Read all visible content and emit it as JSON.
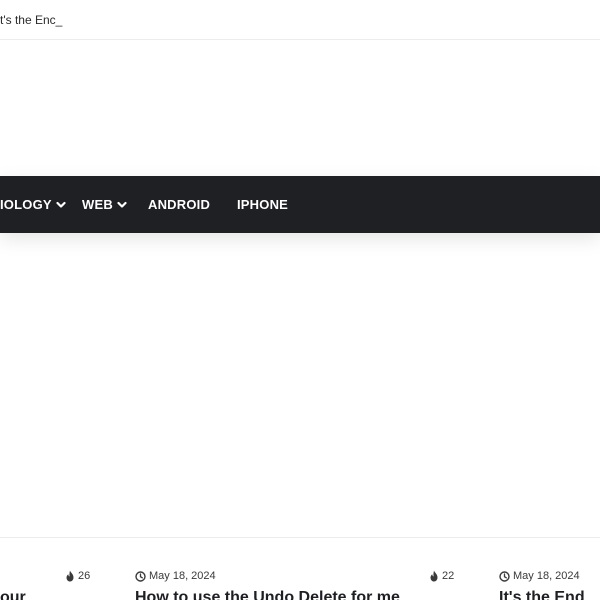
{
  "ticker": {
    "text": "t's the Enc_"
  },
  "nav": {
    "items": [
      {
        "label": "IOLOGY",
        "has_dropdown": true
      },
      {
        "label": "WEB",
        "has_dropdown": true
      },
      {
        "label": "ANDROID",
        "has_dropdown": false
      },
      {
        "label": "IPHONE",
        "has_dropdown": false
      }
    ]
  },
  "posts": [
    {
      "views": "26",
      "title": "our",
      "date": ""
    },
    {
      "date": "May 18, 2024",
      "views": "22",
      "title": "How to use the Undo Delete for me"
    },
    {
      "date": "May 18, 2024",
      "title": "It's the End"
    }
  ],
  "icons": {
    "flame": "flame-icon",
    "clock": "clock-icon",
    "chevron": "chevron-down-icon"
  },
  "colors": {
    "nav_bg": "#1f2024",
    "nav_text": "#ffffff",
    "text": "#1d1f23"
  }
}
